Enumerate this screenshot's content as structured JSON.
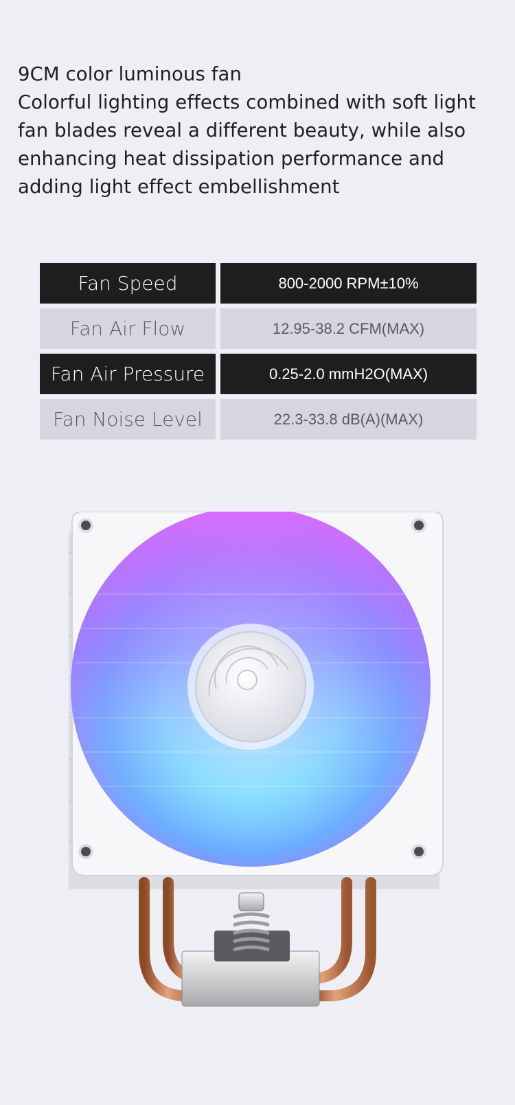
{
  "headline": {
    "line1": "9CM color luminous fan",
    "line2": "Colorful lighting effects combined with soft light",
    "line3": "fan blades reveal a different beauty, while also",
    "line4": "enhancing heat dissipation performance and",
    "line5": "adding light effect embellishment"
  },
  "specs": [
    {
      "label": "Fan Speed",
      "value": "800-2000 RPM±10%"
    },
    {
      "label": "Fan Air Flow",
      "value": "12.95-38.2 CFM(MAX)"
    },
    {
      "label": "Fan Air Pressure",
      "value": "0.25-2.0 mmH2O(MAX)"
    },
    {
      "label": "Fan Noise Level",
      "value": "22.3-33.8 dB(A)(MAX)"
    }
  ],
  "colors": {
    "background": "#eeeef5",
    "row_dark": "#1e1e1e",
    "row_light": "#d6d6e1",
    "fan_pink": "#d76cff",
    "fan_blue": "#5fa8ff",
    "fan_cyan": "#6ff0ff",
    "copper": "#c87a4a"
  },
  "product": {
    "icon": "cpu-cooler-rgb-fan-icon"
  }
}
